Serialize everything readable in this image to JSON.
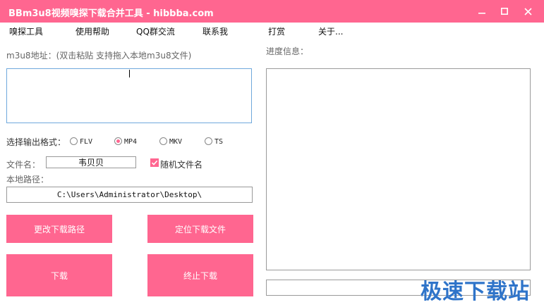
{
  "window": {
    "title": "BBm3u8视频嗅探下载合并工具 - hibbba.com",
    "accent_color": "#ff6690",
    "controls": {
      "minimize_icon": "minimize-icon",
      "maximize_icon": "maximize-icon",
      "close_icon": "close-icon"
    }
  },
  "menu": {
    "items": [
      "嗅探工具",
      "使用帮助",
      "QQ群交流",
      "联系我",
      "打赏",
      "关于..."
    ]
  },
  "form": {
    "m3u8_label": "m3u8地址：(双击粘贴 支持拖入本地m3u8文件)",
    "m3u8_value": "",
    "format_label": "选择输出格式：",
    "formats": [
      "FLV",
      "MP4",
      "MKV",
      "TS"
    ],
    "selected_format": "MP4",
    "filename_label": "文件名：",
    "filename_value": "韦贝贝",
    "random_name_label": "随机文件名",
    "random_name_checked": true,
    "path_label": "本地路径：",
    "path_value": "C:\\Users\\Administrator\\Desktop\\"
  },
  "buttons": {
    "change_path": "更改下载路径",
    "locate_file": "定位下载文件",
    "download": "下载",
    "stop": "终止下载"
  },
  "progress": {
    "label": "进度信息："
  },
  "watermark": {
    "text": "极速下载站"
  }
}
